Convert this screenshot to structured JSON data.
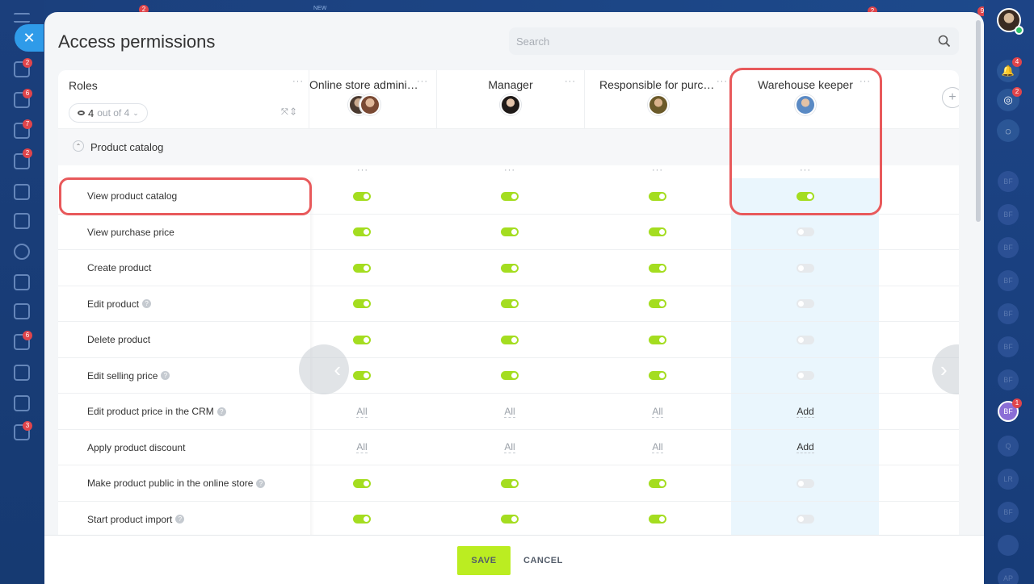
{
  "background": {
    "top_badges": [
      "2",
      "2",
      "9"
    ],
    "top_label": "NEW",
    "left_rail_badges": [
      "2",
      "6",
      "7",
      "2",
      "6",
      "3"
    ],
    "right_rail": {
      "notifications_badge": "4",
      "messages_badge": "2",
      "avatars": [
        "BF",
        "BF",
        "BF",
        "BF",
        "BF",
        "BF",
        "BF",
        "BF",
        "Q",
        "LR",
        "BF",
        "",
        "AP"
      ],
      "active_avatar_badge": "1"
    }
  },
  "modal": {
    "title": "Access permissions",
    "search": {
      "placeholder": "Search"
    },
    "roles_header": {
      "label": "Roles",
      "more": "···",
      "filter_count": "4",
      "filter_text": "out of 4"
    },
    "columns": [
      {
        "title": "Online store administr...",
        "more": "···"
      },
      {
        "title": "Manager",
        "more": "···"
      },
      {
        "title": "Responsible for purch...",
        "more": "···"
      },
      {
        "title": "Warehouse keeper",
        "more": "···"
      }
    ],
    "section": {
      "label": "Product catalog"
    },
    "rows": [
      {
        "label": "View product catalog",
        "help": false,
        "values": [
          "on",
          "on",
          "on",
          "on"
        ]
      },
      {
        "label": "View purchase price",
        "help": false,
        "values": [
          "on",
          "on",
          "on",
          "off"
        ]
      },
      {
        "label": "Create product",
        "help": false,
        "values": [
          "on",
          "on",
          "on",
          "off"
        ]
      },
      {
        "label": "Edit product",
        "help": true,
        "values": [
          "on",
          "on",
          "on",
          "off"
        ]
      },
      {
        "label": "Delete product",
        "help": false,
        "values": [
          "on",
          "on",
          "on",
          "off"
        ]
      },
      {
        "label": "Edit selling price",
        "help": true,
        "values": [
          "on",
          "on",
          "on",
          "off"
        ]
      },
      {
        "label": "Edit product price in the CRM",
        "help": true,
        "values": [
          "All",
          "All",
          "All",
          "Add"
        ]
      },
      {
        "label": "Apply product discount",
        "help": false,
        "values": [
          "All",
          "All",
          "All",
          "Add"
        ]
      },
      {
        "label": "Make product public in the online store",
        "help": true,
        "values": [
          "on",
          "on",
          "on",
          "off"
        ]
      },
      {
        "label": "Start product import",
        "help": true,
        "values": [
          "on",
          "on",
          "on",
          "off"
        ]
      }
    ],
    "footer": {
      "save_label": "SAVE",
      "cancel_label": "CANCEL"
    }
  },
  "colors": {
    "toggle_on": "#a4dd20",
    "save_button": "#bbed21",
    "highlight": "#e8595b",
    "warehouse_column": "#eaf6fd"
  }
}
